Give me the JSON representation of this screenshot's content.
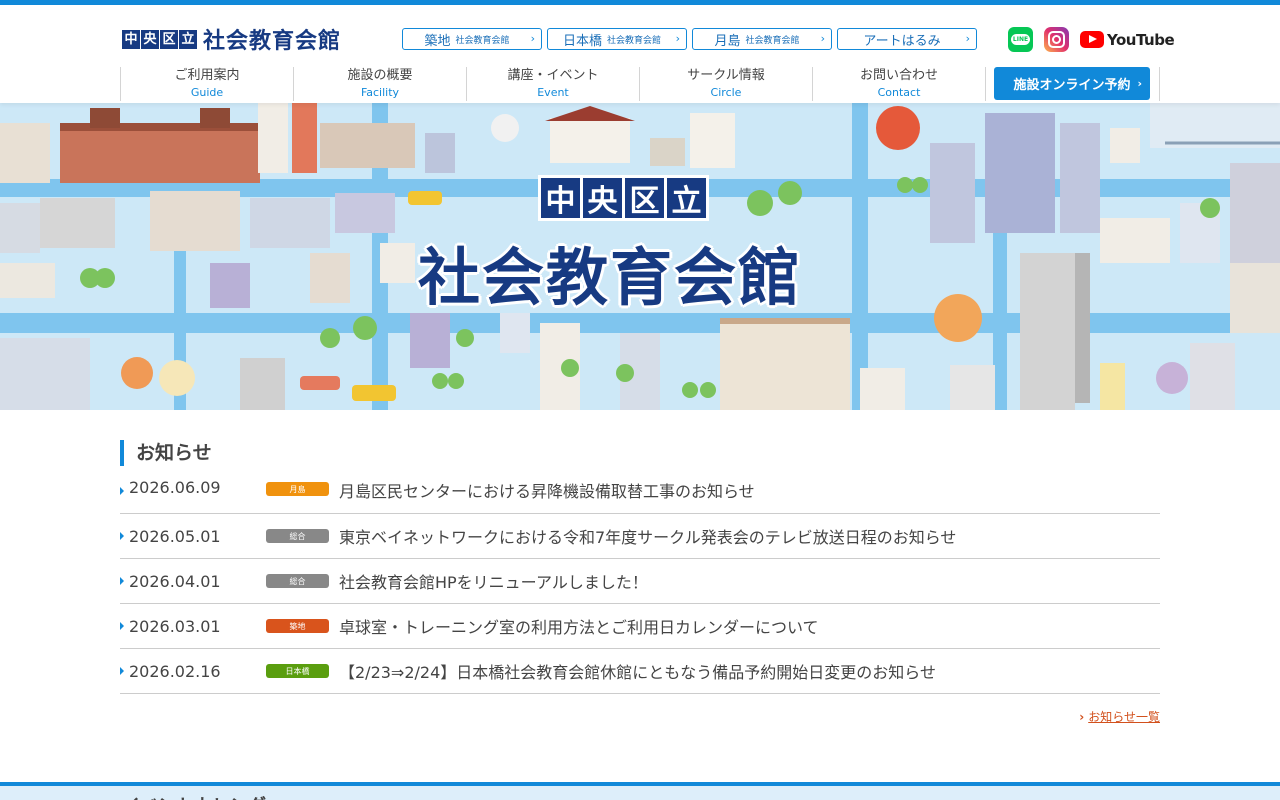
{
  "header": {
    "logo": {
      "ku_chars": [
        "中",
        "央",
        "区",
        "立"
      ],
      "name": "社会教育会館"
    },
    "facility_links": [
      {
        "main": "築地",
        "sub": "社会教育会館"
      },
      {
        "main": "日本橋",
        "sub": "社会教育会館"
      },
      {
        "main": "月島",
        "sub": "社会教育会館"
      },
      {
        "main": "アートはるみ",
        "sub": ""
      }
    ],
    "social": {
      "line_label": "LINE",
      "youtube_label": "YouTube"
    }
  },
  "nav": {
    "items": [
      {
        "ja": "ご利用案内",
        "en": "Guide"
      },
      {
        "ja": "施設の概要",
        "en": "Facility"
      },
      {
        "ja": "講座・イベント",
        "en": "Event"
      },
      {
        "ja": "サークル情報",
        "en": "Circle"
      },
      {
        "ja": "お問い合わせ",
        "en": "Contact"
      }
    ],
    "reserve_label": "施設オンライン予約"
  },
  "hero": {
    "kuritsu": [
      "中",
      "央",
      "区",
      "立"
    ],
    "title": "社会教育会館"
  },
  "news": {
    "heading": "お知らせ",
    "items": [
      {
        "date": "2026.06.09",
        "tag": "月島",
        "tag_color": "#f0920e",
        "title": "月島区民センターにおける昇降機設備取替工事のお知らせ"
      },
      {
        "date": "2026.05.01",
        "tag": "総合",
        "tag_color": "#888888",
        "title": "東京ベイネットワークにおける令和7年度サークル発表会のテレビ放送日程のお知らせ"
      },
      {
        "date": "2026.04.01",
        "tag": "総合",
        "tag_color": "#888888",
        "title": "社会教育会館HPをリニューアルしました！"
      },
      {
        "date": "2026.03.01",
        "tag": "築地",
        "tag_color": "#d9541c",
        "title": "卓球室・トレーニング室の利用方法とご利用日カレンダーについて"
      },
      {
        "date": "2026.02.16",
        "tag": "日本橋",
        "tag_color": "#5a9e0f",
        "title": "【2/23⇒2/24】日本橋社会教育会館休館にともなう備品予約開始日変更のお知らせ"
      }
    ],
    "more_label": "お知らせ一覧"
  },
  "bottom": {
    "title": "イベントカレンダー"
  },
  "colors": {
    "accent": "#1189d9",
    "brand_navy": "#173a82",
    "link_orange": "#d2501c"
  }
}
